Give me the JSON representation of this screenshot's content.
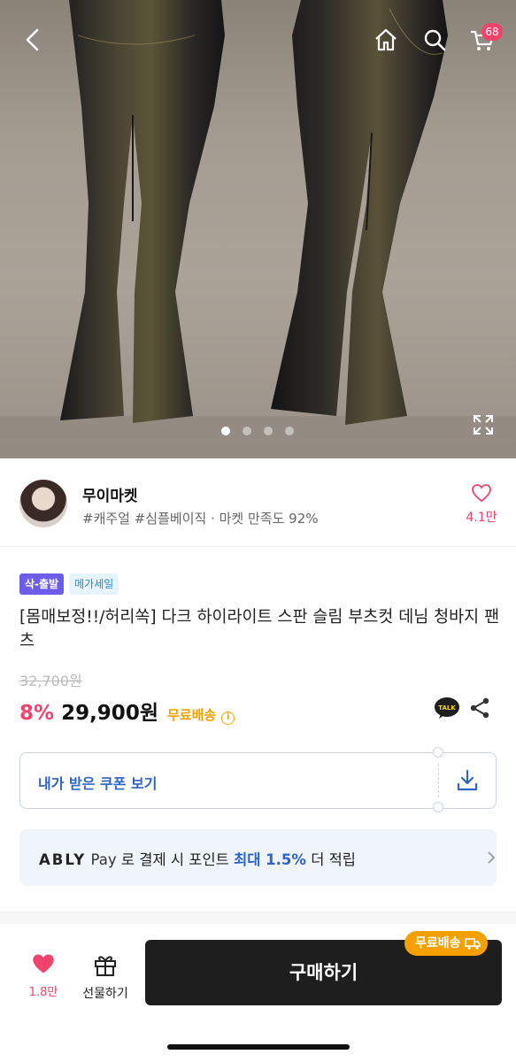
{
  "header": {
    "cart_badge": "68"
  },
  "gallery": {
    "slide_count": 4,
    "active_slide": 1
  },
  "shop": {
    "name": "무이마켓",
    "tags": "#캐주얼 #심플베이직 · 마켓 만족도 92%",
    "likes": "4.1만"
  },
  "product": {
    "badges": [
      "삭-출발",
      "메가세일"
    ],
    "title": "[몸매보정!!/허리쏙] 다크 하이라이트 스판 슬림 부츠컷 데님 청바지 팬츠",
    "original_price": "32,700원",
    "discount": "8%",
    "price": "29,900원",
    "free_shipping": "무료배송",
    "talk_label": "TALK"
  },
  "coupon": {
    "label": "내가 받은 쿠폰 보기"
  },
  "ably_pay": {
    "brand": "ABLY",
    "brand2": "Pay",
    "text_before": " 로 결제 시 포인트 ",
    "highlight": "최대 1.5%",
    "text_after": " 더 적립"
  },
  "bottom_bar": {
    "likes": "1.8만",
    "gift_label": "선물하기",
    "buy_label": "구매하기",
    "ship_chip": "무료배송"
  },
  "colors": {
    "accent_pink": "#f0436b",
    "accent_blue": "#2d64c8",
    "shipping_orange": "#f4a100",
    "buy_button": "#1e1e1e"
  },
  "icons": [
    "back-icon",
    "home-icon",
    "search-icon",
    "cart-icon",
    "expand-icon",
    "heart-icon",
    "kakaotalk-icon",
    "share-icon",
    "download-icon",
    "chevron-right-icon",
    "gift-icon",
    "truck-icon"
  ]
}
